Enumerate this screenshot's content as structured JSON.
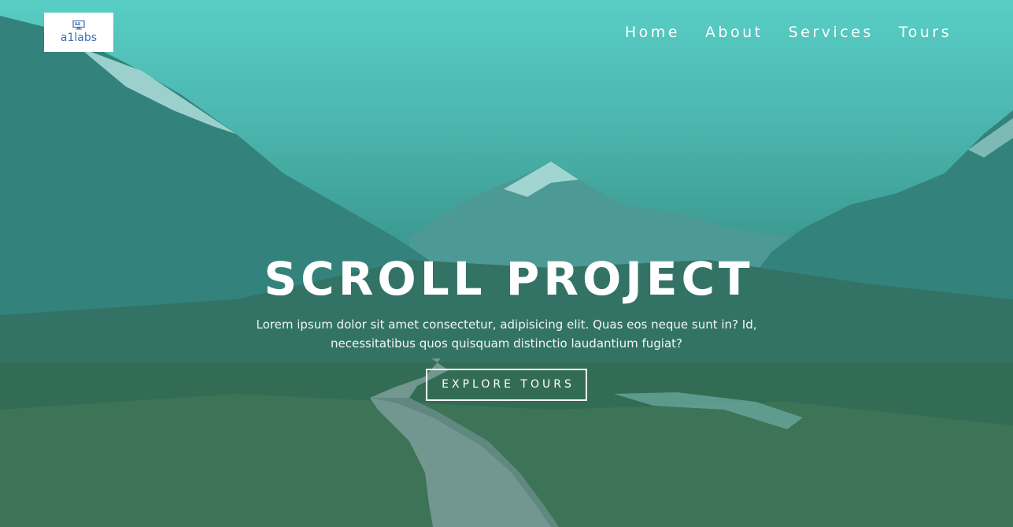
{
  "logo": {
    "text": "a1labs",
    "icon": "monitor-icon"
  },
  "nav": {
    "links": [
      {
        "label": "Home"
      },
      {
        "label": "About"
      },
      {
        "label": "Services"
      },
      {
        "label": "Tours"
      }
    ]
  },
  "hero": {
    "title": "SCROLL PROJECT",
    "subtitle": "Lorem ipsum dolor sit amet consectetur, adipisicing elit. Quas eos neque sunt in? Id, necessitatibus quos quisquam distinctio laudantium fugiat?",
    "button_label": "EXPLORE TOURS",
    "overlay_color": "#46c8be"
  }
}
